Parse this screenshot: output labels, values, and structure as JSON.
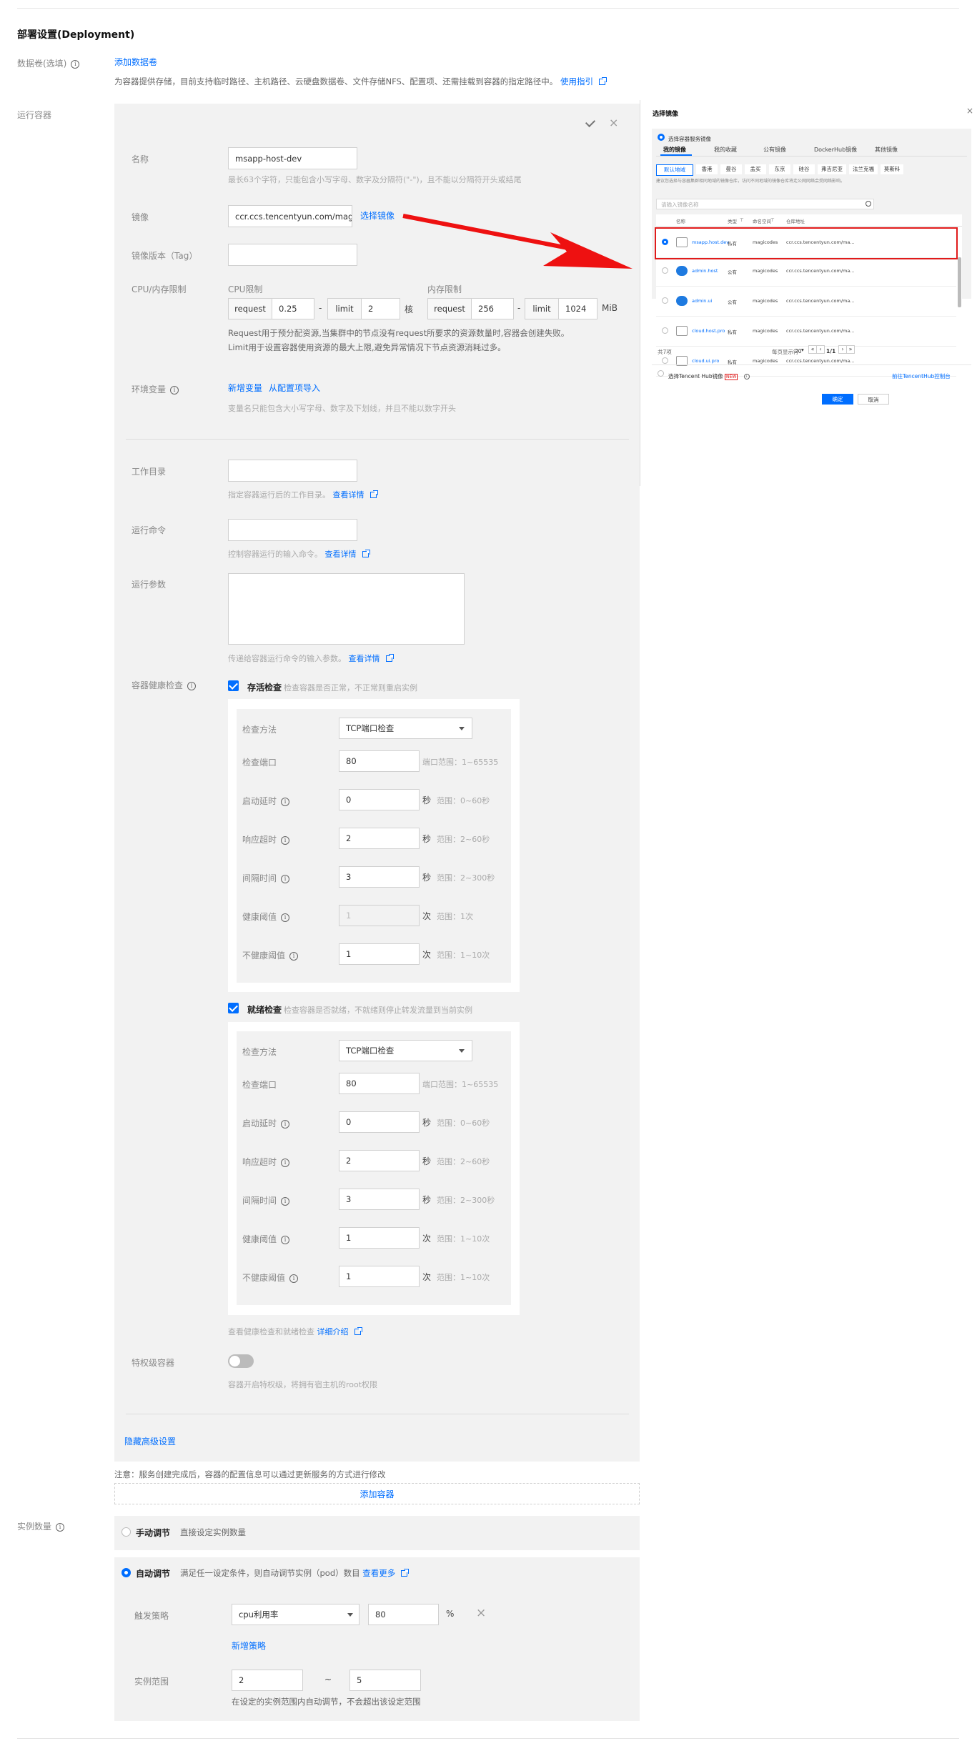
{
  "section_title": "部署设置(Deployment)",
  "volume": {
    "label": "数据卷(选填)",
    "add_link": "添加数据卷",
    "desc": "为容器提供存储，目前支持临时路径、主机路径、云硬盘数据卷、文件存储NFS、配置项、还需挂载到容器的指定路径中。",
    "guide_link": "使用指引"
  },
  "container": {
    "section_label": "运行容器",
    "name_label": "名称",
    "name_value": "msapp-host-dev",
    "name_hint": "最长63个字符，只能包含小写字母、数字及分隔符(\"-\")，且不能以分隔符开头或结尾",
    "image_label": "镜像",
    "image_value": "ccr.ccs.tencentyun.com/magi",
    "image_select_link": "选择镜像",
    "tag_label": "镜像版本（Tag）",
    "cpu_mem_label": "CPU/内存限制",
    "cpu_label": "CPU限制",
    "mem_label": "内存限制",
    "request": "request",
    "limit": "limit",
    "cpu_request": "0.25",
    "cpu_limit": "2",
    "cpu_unit": "核",
    "mem_request": "256",
    "mem_limit": "1024",
    "mem_unit": "MiB",
    "dash": "-",
    "resource_note1": "Request用于预分配资源,当集群中的节点没有request所要求的资源数量时,容器会创建失败。",
    "resource_note2": "Limit用于设置容器使用资源的最大上限,避免异常情况下节点资源消耗过多。",
    "env_label": "环境变量",
    "env_add": "新增变量",
    "env_import": "从配置项导入",
    "env_hint": "变量名只能包含大小写字母、数字及下划线，并且不能以数字开头",
    "workdir_label": "工作目录",
    "workdir_hint": "指定容器运行后的工作目录。",
    "cmd_label": "运行命令",
    "cmd_hint": "控制容器运行的输入命令。",
    "args_label": "运行参数",
    "args_hint": "传递给容器运行命令的输入参数。",
    "detail_link": "查看详情",
    "health_label": "容器健康检查",
    "liveness_title": "存活检查",
    "liveness_desc": "检查容器是否正常，不正常则重启实例",
    "readiness_title": "就绪检查",
    "readiness_desc": "检查容器是否就绪，不就绪则停止转发流量到当前实例",
    "probe_labels": {
      "method": "检查方法",
      "port": "检查端口",
      "delay": "启动延时",
      "timeout": "响应超时",
      "period": "间隔时间",
      "success": "健康阈值",
      "failure": "不健康阈值"
    },
    "units": {
      "sec": "秒",
      "times": "次"
    },
    "liveness": {
      "method": "TCP端口检查",
      "port": "80",
      "port_hint": "端口范围：1~65535",
      "delay": "0",
      "delay_hint": "范围：0~60秒",
      "timeout": "2",
      "timeout_hint": "范围：2~60秒",
      "period": "3",
      "period_hint": "范围：2~300秒",
      "success": "1",
      "success_hint": "范围：1次",
      "failure": "1",
      "failure_hint": "范围：1~10次"
    },
    "readiness": {
      "method": "TCP端口检查",
      "port": "80",
      "port_hint": "端口范围：1~65535",
      "delay": "0",
      "delay_hint": "范围：0~60秒",
      "timeout": "2",
      "timeout_hint": "范围：2~60秒",
      "period": "3",
      "period_hint": "范围：2~300秒",
      "success": "1",
      "success_hint": "范围：1~10次",
      "failure": "1",
      "failure_hint": "范围：1~10次"
    },
    "probe_doc": "查看健康检查和就绪检查",
    "probe_doc_link": "详细介绍",
    "privileged_label": "特权级容器",
    "privileged_hint": "容器开启特权级，将拥有宿主机的root权限",
    "hide_advanced": "隐藏高级设置",
    "note": "注意：服务创建完成后，容器的配置信息可以通过更新服务的方式进行修改",
    "add_container": "添加容器"
  },
  "replicas": {
    "label": "实例数量",
    "manual_title": "手动调节",
    "manual_desc": "直接设定实例数量",
    "auto_title": "自动调节",
    "auto_desc": "满足任一设定条件，则自动调节实例（pod）数目",
    "auto_more": "查看更多",
    "trigger_label": "触发策略",
    "trigger_metric": "cpu利用率",
    "trigger_value": "80",
    "trigger_unit": "%",
    "add_policy": "新增策略",
    "range_label": "实例范围",
    "range_min": "2",
    "range_sep": "~",
    "range_max": "5",
    "range_hint": "在设定的实例范围内自动调节，不会超出该设定范围"
  },
  "dialog": {
    "title": "选择镜像",
    "source_option": "选择容器服务镜像",
    "tabs": [
      "我的镜像",
      "我的收藏",
      "公有镜像",
      "DockerHub镜像",
      "其他镜像"
    ],
    "regions": [
      "默认地域",
      "香港",
      "曼谷",
      "孟买",
      "东京",
      "硅谷",
      "弗吉尼亚",
      "法兰克福",
      "莫斯科"
    ],
    "region_note": "建议您选择与容器集群相同地域的镜像仓库，访问不同地域的镜像仓库将走公网网络会受网络影响。",
    "search_placeholder": "请输入镜像名称",
    "columns": [
      "名称",
      "类型",
      "命名空间",
      "仓库地址"
    ],
    "rows": [
      {
        "name": "msapp.host.dev",
        "type": "私有",
        "ns": "magicodes",
        "addr": "ccr.ccs.tencentyun.com/ma..."
      },
      {
        "name": "admin.host",
        "type": "公有",
        "ns": "magicodes",
        "addr": "ccr.ccs.tencentyun.com/ma..."
      },
      {
        "name": "admin.ui",
        "type": "公有",
        "ns": "magicodes",
        "addr": "ccr.ccs.tencentyun.com/ma..."
      },
      {
        "name": "cloud.host.pro",
        "type": "私有",
        "ns": "magicodes",
        "addr": "ccr.ccs.tencentyun.com/ma..."
      },
      {
        "name": "cloud.ui.pro",
        "type": "私有",
        "ns": "magicodes",
        "addr": "ccr.ccs.tencentyun.com/ma..."
      }
    ],
    "total": "共7项",
    "page_size_label": "每页显示行",
    "page_size": "20",
    "page": "1/1",
    "tencent_hub": "选择Tencent Hub镜像",
    "new_badge": "NEW",
    "hub_link": "前往TencentHub控制台",
    "ok": "确定",
    "cancel": "取消"
  },
  "colors": {
    "accent": "#006eff",
    "arrow": "#ee1111",
    "highlight": "#e01b1b"
  }
}
